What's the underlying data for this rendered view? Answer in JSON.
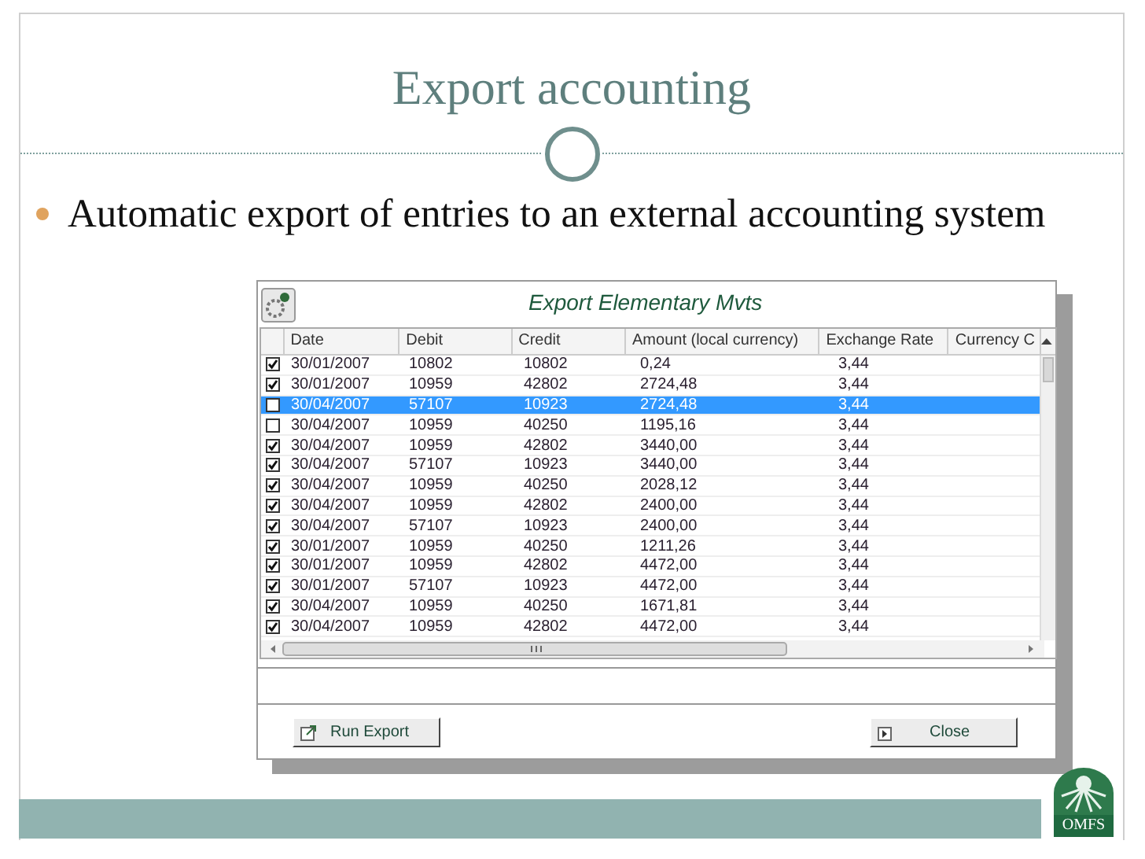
{
  "slide": {
    "title": "Export accounting",
    "bullets": [
      "Automatic export of entries to an external accounting system"
    ]
  },
  "window": {
    "title": "Export Elementary Mvts"
  },
  "table": {
    "columns": [
      "Date",
      "Debit",
      "Credit",
      "Amount (local currency)",
      "Exchange Rate",
      "Currency C"
    ],
    "rows": [
      {
        "checked": true,
        "selected": false,
        "cells": [
          "30/01/2007",
          "10802",
          "10802",
          "0,24",
          "3,44"
        ]
      },
      {
        "checked": true,
        "selected": false,
        "cells": [
          "30/01/2007",
          "10959",
          "42802",
          "2724,48",
          "3,44"
        ]
      },
      {
        "checked": false,
        "selected": true,
        "cells": [
          "30/04/2007",
          "57107",
          "10923",
          "2724,48",
          "3,44"
        ]
      },
      {
        "checked": false,
        "selected": false,
        "cells": [
          "30/04/2007",
          "10959",
          "40250",
          "1195,16",
          "3,44"
        ]
      },
      {
        "checked": true,
        "selected": false,
        "cells": [
          "30/04/2007",
          "10959",
          "42802",
          "3440,00",
          "3,44"
        ]
      },
      {
        "checked": true,
        "selected": false,
        "cells": [
          "30/04/2007",
          "57107",
          "10923",
          "3440,00",
          "3,44"
        ]
      },
      {
        "checked": true,
        "selected": false,
        "cells": [
          "30/04/2007",
          "10959",
          "40250",
          "2028,12",
          "3,44"
        ]
      },
      {
        "checked": true,
        "selected": false,
        "cells": [
          "30/04/2007",
          "10959",
          "42802",
          "2400,00",
          "3,44"
        ]
      },
      {
        "checked": true,
        "selected": false,
        "cells": [
          "30/04/2007",
          "57107",
          "10923",
          "2400,00",
          "3,44"
        ]
      },
      {
        "checked": true,
        "selected": false,
        "cells": [
          "30/01/2007",
          "10959",
          "40250",
          "1211,26",
          "3,44"
        ]
      },
      {
        "checked": true,
        "selected": false,
        "cells": [
          "30/01/2007",
          "10959",
          "42802",
          "4472,00",
          "3,44"
        ]
      },
      {
        "checked": true,
        "selected": false,
        "cells": [
          "30/01/2007",
          "57107",
          "10923",
          "4472,00",
          "3,44"
        ]
      },
      {
        "checked": true,
        "selected": false,
        "cells": [
          "30/04/2007",
          "10959",
          "40250",
          "1671,81",
          "3,44"
        ]
      },
      {
        "checked": true,
        "selected": false,
        "cells": [
          "30/04/2007",
          "10959",
          "42802",
          "4472,00",
          "3,44"
        ]
      }
    ]
  },
  "buttons": [
    "Run Export",
    "Close"
  ],
  "logo": {
    "text": "OMFS"
  }
}
